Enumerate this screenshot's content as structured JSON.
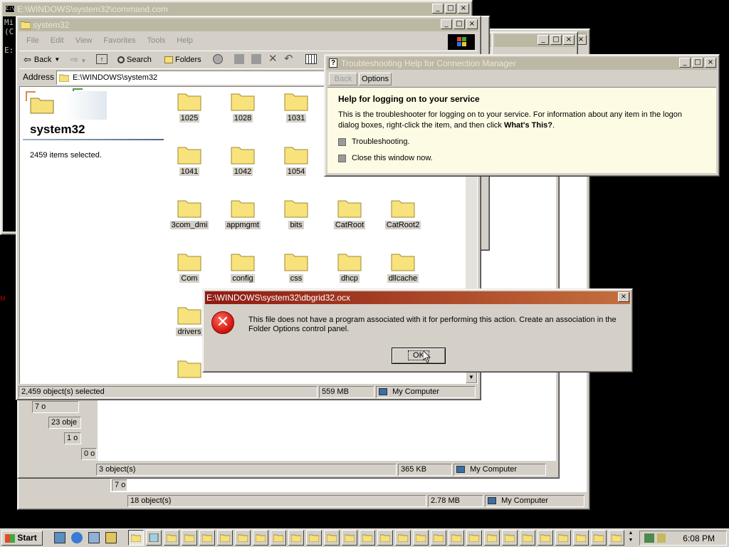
{
  "cmd": {
    "title": "E:\\WINDOWS\\system32\\command.com",
    "text_lines": [
      "Mi",
      "(C",
      "",
      "E:"
    ]
  },
  "back_windows": {
    "status_labels": [
      "7 o",
      "23 obje",
      "1 o",
      "0 o",
      "7 o"
    ],
    "w3_status": {
      "count": "3 object(s)",
      "size": "365 KB",
      "zone": "My Computer"
    },
    "w4_status": {
      "count": "18 object(s)",
      "size": "2.78 MB",
      "zone": "My Computer"
    }
  },
  "explorer": {
    "title": "system32",
    "menu": [
      "File",
      "Edit",
      "View",
      "Favorites",
      "Tools",
      "Help"
    ],
    "toolbar": {
      "back": "Back",
      "search": "Search",
      "folders": "Folders"
    },
    "address_label": "Address",
    "address_value": "E:\\WINDOWS\\system32",
    "panel_title": "system32",
    "panel_info": "2459 items selected.",
    "folders": [
      "1025",
      "1028",
      "1031",
      "1041",
      "1042",
      "1054",
      "3com_dmi",
      "appmgmt",
      "bits",
      "CatRoot",
      "CatRoot2",
      "Com",
      "config",
      "css",
      "dhcp",
      "dllcache",
      "drivers"
    ],
    "status": {
      "count": "2,459 object(s) selected",
      "size": "559 MB",
      "zone": "My Computer"
    }
  },
  "help": {
    "title": "Troubleshooting Help for Connection Manager",
    "back_button": "Back",
    "options_button": "Options",
    "heading": "Help for logging on to your service",
    "body_text": "This is the troubleshooter for logging on to your service. For information about any item in the logon dialog boxes, right-click the item, and then click",
    "body_bold": "What's This?",
    "body_end": ".",
    "options": [
      "Troubleshooting.",
      "Close this window now."
    ]
  },
  "error_dialog": {
    "title": "E:\\WINDOWS\\system32\\dbgrid32.ocx",
    "message": "This file does not have a program associated with it for performing this action. Create an association in the Folder Options control panel.",
    "ok_label": "OK"
  },
  "taskbar": {
    "start_label": "Start",
    "clock": "6:08 PM"
  },
  "colors": {
    "active_title_start": "#8e1a12",
    "active_title_end": "#c46f3e",
    "inactive_title": "#bdb8a3",
    "desktop": "#000000"
  }
}
